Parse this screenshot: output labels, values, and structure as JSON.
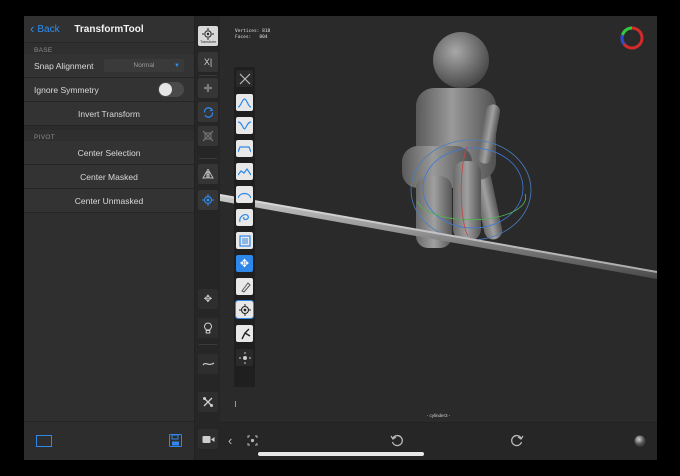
{
  "header": {
    "back_label": "Back",
    "title": "TransformTool"
  },
  "sections": {
    "base": {
      "label": "BASE",
      "snap_alignment": {
        "label": "Snap Alignment",
        "value": "Normal"
      },
      "ignore_symmetry": {
        "label": "Ignore Symmetry",
        "on": false
      },
      "invert_transform": "Invert Transform"
    },
    "pivot": {
      "label": "PIVOT",
      "buttons": [
        "Center Selection",
        "Center Masked",
        "Center Unmasked"
      ]
    }
  },
  "toolbar": {
    "transform_label": "Transform",
    "icons": [
      "transform-icon",
      "symmetry-x-icon",
      "move-icon",
      "rotate-icon",
      "scale-icon",
      "mirror-icon",
      "pivot-icon",
      "pan-icon",
      "lightbulb-icon",
      "stroke-icon",
      "settings-icon",
      "camera-icon"
    ]
  },
  "viewport": {
    "stats": {
      "vertices_label": "Vertices:",
      "vertices": "818",
      "faces_label": "Faces:",
      "faces": "804"
    },
    "object_name": "- cylinder3 -"
  },
  "palette": {
    "tools": [
      {
        "icon": "close-icon",
        "label": ""
      },
      {
        "icon": "brush-icon",
        "label": ""
      },
      {
        "icon": "crease-icon",
        "label": "Crease"
      },
      {
        "icon": "inflate-icon",
        "label": "Inflate"
      },
      {
        "icon": "smooth-icon",
        "label": "Smooth"
      },
      {
        "icon": "flatten-icon",
        "label": "Flatten"
      },
      {
        "icon": "layer-icon",
        "label": "Layer"
      },
      {
        "icon": "mask-icon",
        "label": "Masking"
      },
      {
        "icon": "move-brush-icon",
        "label": "Move"
      },
      {
        "icon": "paint-icon",
        "label": "Paint"
      },
      {
        "icon": "transform-brush-icon",
        "label": ""
      },
      {
        "icon": "pinch-icon",
        "label": "Pinch"
      },
      {
        "icon": "more-icon",
        "label": ""
      }
    ]
  },
  "colors": {
    "accent": "#2e88ea",
    "panel": "#2f2f2f",
    "viewport": "#2a2a2a"
  }
}
